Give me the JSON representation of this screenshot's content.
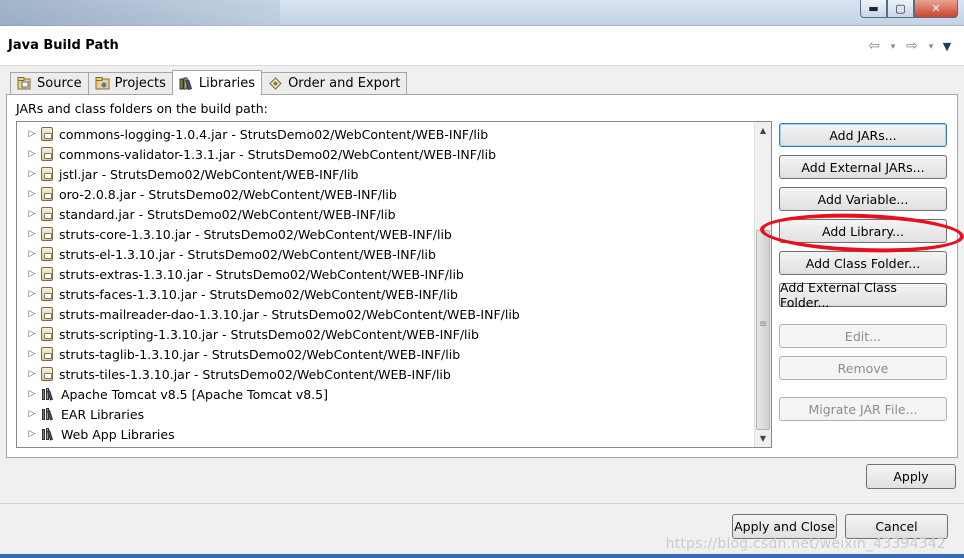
{
  "window": {
    "minimize_glyph": "▬",
    "maximize_glyph": "▢",
    "close_glyph": "✕"
  },
  "header": {
    "title": "Java Build Path",
    "back_glyph": "⇦",
    "forward_glyph": "⇨",
    "dropdown_glyph": "▾",
    "menu_glyph": "▼"
  },
  "tabs": [
    {
      "label": "Source",
      "icon": "source-icon",
      "active": false
    },
    {
      "label": "Projects",
      "icon": "projects-icon",
      "active": false
    },
    {
      "label": "Libraries",
      "icon": "libraries-icon",
      "active": true
    },
    {
      "label": "Order and Export",
      "icon": "order-export-icon",
      "active": false
    }
  ],
  "libraries": {
    "caption": "JARs and class folders on the build path:",
    "entries": [
      {
        "text": "commons-logging-1.0.4.jar - StrutsDemo02/WebContent/WEB-INF/lib",
        "icon": "jar-icon"
      },
      {
        "text": "commons-validator-1.3.1.jar - StrutsDemo02/WebContent/WEB-INF/lib",
        "icon": "jar-icon"
      },
      {
        "text": "jstl.jar - StrutsDemo02/WebContent/WEB-INF/lib",
        "icon": "jar-icon"
      },
      {
        "text": "oro-2.0.8.jar - StrutsDemo02/WebContent/WEB-INF/lib",
        "icon": "jar-icon"
      },
      {
        "text": "standard.jar - StrutsDemo02/WebContent/WEB-INF/lib",
        "icon": "jar-icon"
      },
      {
        "text": "struts-core-1.3.10.jar - StrutsDemo02/WebContent/WEB-INF/lib",
        "icon": "jar-icon"
      },
      {
        "text": "struts-el-1.3.10.jar - StrutsDemo02/WebContent/WEB-INF/lib",
        "icon": "jar-icon"
      },
      {
        "text": "struts-extras-1.3.10.jar - StrutsDemo02/WebContent/WEB-INF/lib",
        "icon": "jar-icon"
      },
      {
        "text": "struts-faces-1.3.10.jar - StrutsDemo02/WebContent/WEB-INF/lib",
        "icon": "jar-icon"
      },
      {
        "text": "struts-mailreader-dao-1.3.10.jar - StrutsDemo02/WebContent/WEB-INF/lib",
        "icon": "jar-icon"
      },
      {
        "text": "struts-scripting-1.3.10.jar - StrutsDemo02/WebContent/WEB-INF/lib",
        "icon": "jar-icon"
      },
      {
        "text": "struts-taglib-1.3.10.jar - StrutsDemo02/WebContent/WEB-INF/lib",
        "icon": "jar-icon"
      },
      {
        "text": "struts-tiles-1.3.10.jar - StrutsDemo02/WebContent/WEB-INF/lib",
        "icon": "jar-icon"
      },
      {
        "text": "Apache Tomcat v8.5 [Apache Tomcat v8.5]",
        "icon": "library-icon"
      },
      {
        "text": "EAR Libraries",
        "icon": "library-icon"
      },
      {
        "text": "Web App Libraries",
        "icon": "library-icon"
      }
    ],
    "expander_glyph": "▷",
    "scroll_up_glyph": "▲",
    "scroll_down_glyph": "▼"
  },
  "buttons": {
    "add_jars": "Add JARs...",
    "add_external_jars": "Add External JARs...",
    "add_variable": "Add Variable...",
    "add_library": "Add Library...",
    "add_class_folder": "Add Class Folder...",
    "add_external_class_folder": "Add External Class Folder...",
    "edit": "Edit...",
    "remove": "Remove",
    "migrate_jar": "Migrate JAR File...",
    "apply": "Apply",
    "apply_and_close": "Apply and Close",
    "cancel": "Cancel"
  },
  "annotation_color": "#e8101a",
  "watermark": "https://blog.csdn.net/weixin_43394342"
}
